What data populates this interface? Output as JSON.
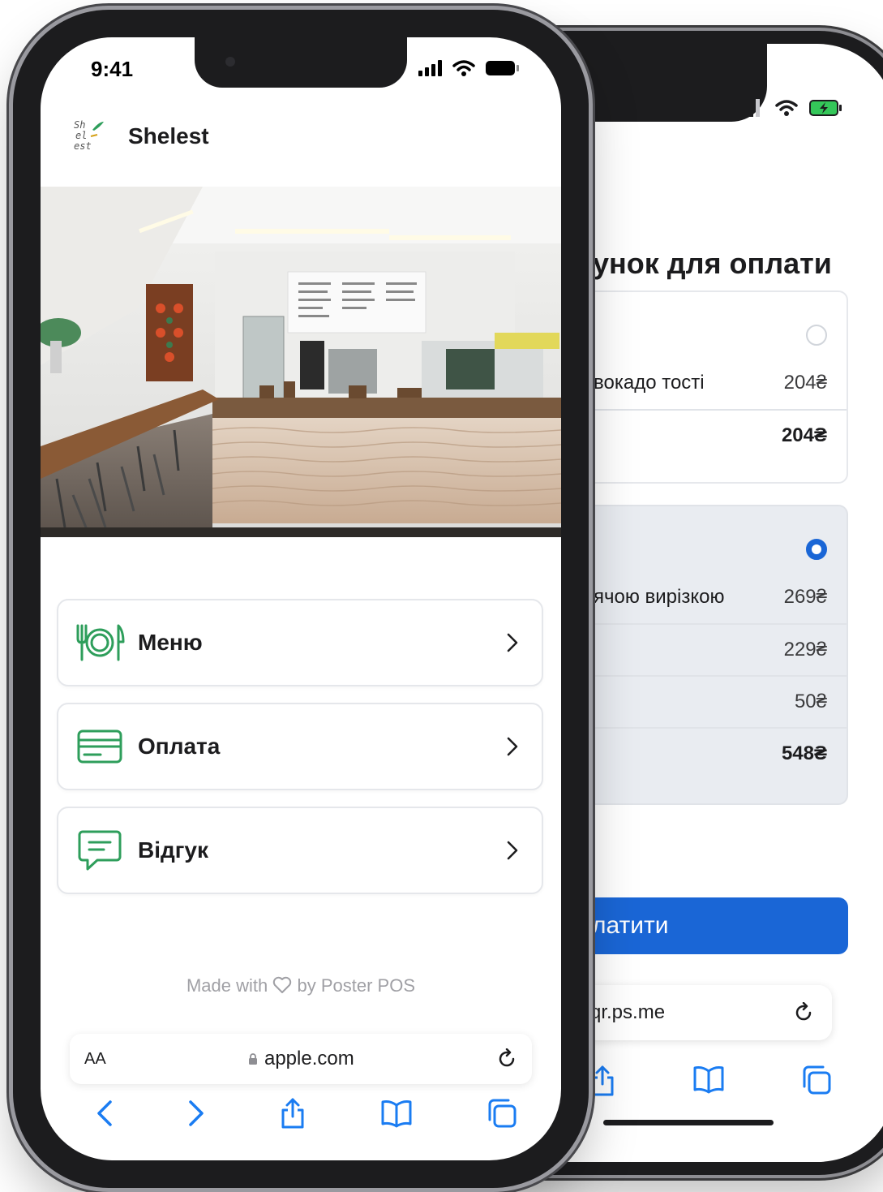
{
  "colors": {
    "accent_green": "#2e9e5b",
    "accent_blue": "#1a66d6",
    "safari_blue": "#1a7cf2",
    "text_primary": "#1c1c1e",
    "muted": "#a0a0a5"
  },
  "front": {
    "status": {
      "time": "9:41"
    },
    "brand": {
      "logo_text": "Sh el est",
      "name": "Shelest"
    },
    "hero_image": "cafe-interior",
    "menu_items": [
      {
        "label": "Меню",
        "icon": "plate-cutlery-icon"
      },
      {
        "label": "Оплата",
        "icon": "card-icon"
      },
      {
        "label": "Відгук",
        "icon": "feedback-icon"
      }
    ],
    "footer": {
      "before": "Made with",
      "after": "by Poster POS"
    },
    "browser": {
      "aa": "AA",
      "host": "apple.com"
    }
  },
  "back": {
    "title": "унок для оплати",
    "bill_a": {
      "items": [
        {
          "name": "вокадо тості",
          "price": "204₴"
        }
      ],
      "total": "204₴"
    },
    "bill_b": {
      "items": [
        {
          "name": "ячою вирізкою",
          "price": "269₴"
        },
        {
          "name": "",
          "price": "229₴"
        },
        {
          "name": "",
          "price": "50₴"
        }
      ],
      "total": "548₴"
    },
    "pay_button": "латити",
    "browser": {
      "host": "qr.ps.me"
    }
  }
}
